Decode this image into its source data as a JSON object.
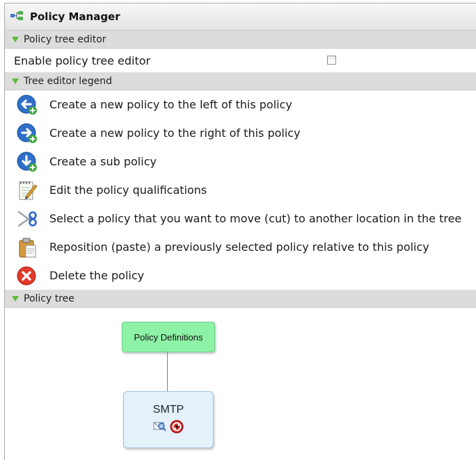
{
  "window": {
    "title": "Policy Manager",
    "icon": "tree-structure-icon"
  },
  "sections": {
    "editor": {
      "label": "Policy tree editor"
    },
    "legend": {
      "label": "Tree editor legend"
    },
    "tree": {
      "label": "Policy tree"
    }
  },
  "editor": {
    "enable_label": "Enable policy tree editor",
    "enabled": false
  },
  "legend": {
    "items": [
      {
        "icon": "arrow-left-add-icon",
        "label": "Create a new policy to the left of this policy"
      },
      {
        "icon": "arrow-right-add-icon",
        "label": "Create a new policy to the right of this policy"
      },
      {
        "icon": "arrow-down-add-icon",
        "label": "Create a sub policy"
      },
      {
        "icon": "notepad-pencil-icon",
        "label": "Edit the policy qualifications"
      },
      {
        "icon": "scissors-icon",
        "label": "Select a policy that you want to move (cut) to another location in the tree"
      },
      {
        "icon": "clipboard-paste-icon",
        "label": "Reposition (paste) a previously selected policy relative to this policy"
      },
      {
        "icon": "delete-x-icon",
        "label": "Delete the policy"
      }
    ]
  },
  "tree": {
    "root": {
      "label": "Policy Definitions",
      "color": "#8ef2a6"
    },
    "child": {
      "label": "SMTP",
      "icons": [
        "mail-scan-icon",
        "disabled-icon"
      ]
    }
  },
  "colors": {
    "section_arrow": "#5fb83a",
    "connector": "#4a89d8",
    "node_child_bg": "#e4f1fb"
  }
}
